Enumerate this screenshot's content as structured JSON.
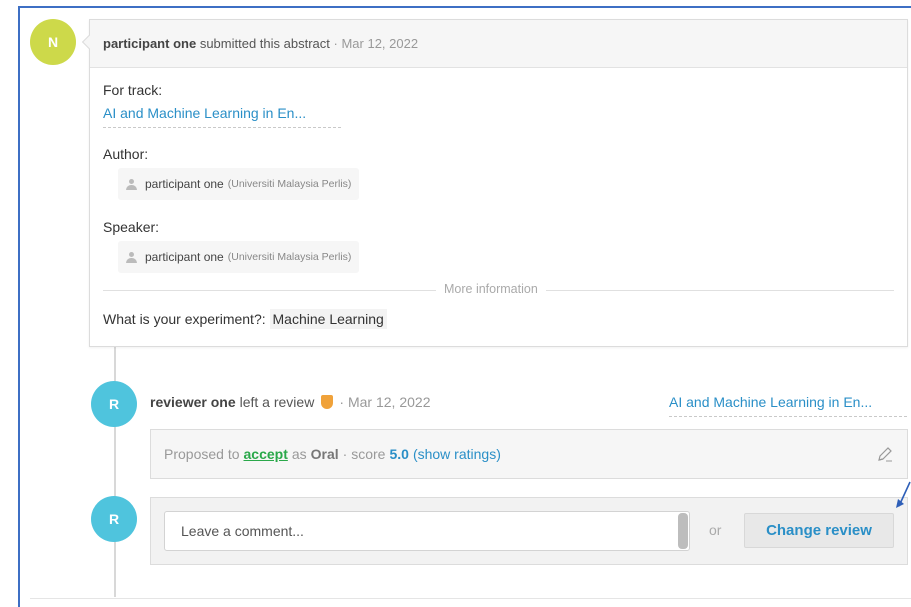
{
  "submission": {
    "avatar_letter": "N",
    "author_name": "participant one",
    "action": "submitted this abstract",
    "separator": "·",
    "date": "Mar 12, 2022",
    "track_label": "For track:",
    "track_value": "AI and Machine Learning in En...",
    "author_label": "Author:",
    "author": {
      "name": "participant one",
      "affiliation": "(Universiti Malaysia Perlis)"
    },
    "speaker_label": "Speaker:",
    "speaker": {
      "name": "participant one",
      "affiliation": "(Universiti Malaysia Perlis)"
    },
    "more_info_label": "More information",
    "experiment_label": "What is your experiment?:",
    "experiment_value": "Machine Learning"
  },
  "review": {
    "avatar_letter": "R",
    "reviewer_name": "reviewer one",
    "action": "left a review",
    "separator": "·",
    "date": "Mar 12, 2022",
    "track_value": "AI and Machine Learning in En...",
    "proposed_prefix": "Proposed to",
    "decision": "accept",
    "as_text": "as",
    "type": "Oral",
    "score_prefix": "· score",
    "score": "5.0",
    "show_ratings": "(show ratings)"
  },
  "comment": {
    "avatar_letter": "R",
    "placeholder": "Leave a comment...",
    "or_text": "or",
    "change_review_label": "Change review"
  },
  "colors": {
    "avatar_submitter": "#cdd94a",
    "avatar_reviewer": "#4fc4dd",
    "link": "#2a8fc7",
    "accept": "#2aa84a",
    "frame": "#3d6fc4"
  },
  "icons": [
    "user-icon",
    "reviewer-badge-icon",
    "pencil-icon",
    "annotation-arrow-icon"
  ]
}
